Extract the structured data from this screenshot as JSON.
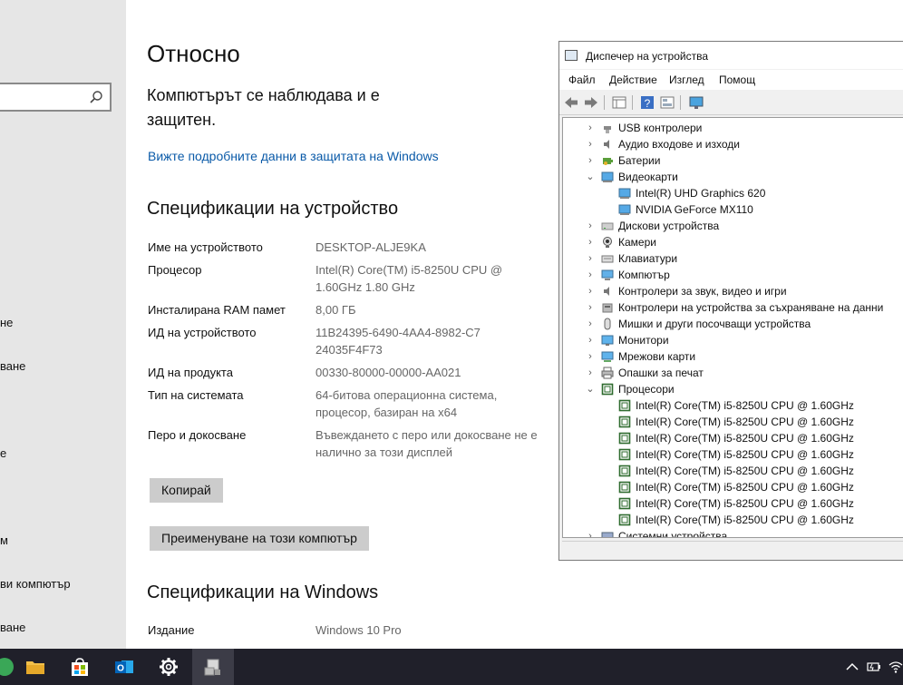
{
  "settings_nav": {
    "search_placeholder": "",
    "items": [
      "не",
      "ване",
      "е",
      "м",
      "ви компютър",
      "ване"
    ]
  },
  "about": {
    "title": "Относно",
    "protection_text": "Компютърът се наблюдава и е защитен.",
    "security_link": "Вижте подробните данни в защитата на Windows",
    "device_specs_title": "Спецификации на устройство",
    "specs": [
      {
        "label": "Име на устройството",
        "value": "DESKTOP-ALJE9KA"
      },
      {
        "label": "Процесор",
        "value": "Intel(R) Core(TM) i5-8250U CPU @ 1.60GHz   1.80 GHz"
      },
      {
        "label": "Инсталирана RAM памет",
        "value": "8,00 ГБ"
      },
      {
        "label": "ИД на устройството",
        "value": "11B24395-6490-4AA4-8982-C724035F4F73"
      },
      {
        "label": "ИД на продукта",
        "value": "00330-80000-00000-AA021"
      },
      {
        "label": "Тип на системата",
        "value": "64-битова операционна система, процесор, базиран на x64"
      },
      {
        "label": "Перо и докосване",
        "value": "Въвеждането с перо или докосване не е налично за този дисплей"
      }
    ],
    "copy_button": "Копирай",
    "rename_button": "Преименуване на този компютър",
    "windows_specs_title": "Спецификации на Windows",
    "edition_label": "Издание",
    "edition_value": "Windows 10 Pro"
  },
  "device_manager": {
    "title": "Диспечер на устройства",
    "menu": [
      "Файл",
      "Действие",
      "Изглед",
      "Помощ"
    ],
    "tree": [
      {
        "label": "USB контролери",
        "level": 0,
        "expanded": false,
        "icon": "usb-icon"
      },
      {
        "label": "Аудио входове и изходи",
        "level": 0,
        "expanded": false,
        "icon": "audio-icon"
      },
      {
        "label": "Батерии",
        "level": 0,
        "expanded": false,
        "icon": "battery-icon"
      },
      {
        "label": "Видеокарти",
        "level": 0,
        "expanded": true,
        "icon": "display-adapter-icon"
      },
      {
        "label": "Intel(R) UHD Graphics 620",
        "level": 1,
        "icon": "display-adapter-icon"
      },
      {
        "label": "NVIDIA GeForce MX110",
        "level": 1,
        "icon": "display-adapter-icon"
      },
      {
        "label": "Дискови устройства",
        "level": 0,
        "expanded": false,
        "icon": "disk-icon"
      },
      {
        "label": "Камери",
        "level": 0,
        "expanded": false,
        "icon": "camera-icon"
      },
      {
        "label": "Клавиатури",
        "level": 0,
        "expanded": false,
        "icon": "keyboard-icon"
      },
      {
        "label": "Компютър",
        "level": 0,
        "expanded": false,
        "icon": "computer-icon"
      },
      {
        "label": "Контролери за звук, видео и игри",
        "level": 0,
        "expanded": false,
        "icon": "speaker-icon"
      },
      {
        "label": "Контролери на устройства за съхраняване на данни",
        "level": 0,
        "expanded": false,
        "icon": "storage-icon"
      },
      {
        "label": "Мишки и други посочващи устройства",
        "level": 0,
        "expanded": false,
        "icon": "mouse-icon"
      },
      {
        "label": "Монитори",
        "level": 0,
        "expanded": false,
        "icon": "monitor-icon"
      },
      {
        "label": "Мрежови карти",
        "level": 0,
        "expanded": false,
        "icon": "network-icon"
      },
      {
        "label": "Опашки за печат",
        "level": 0,
        "expanded": false,
        "icon": "printer-icon"
      },
      {
        "label": "Процесори",
        "level": 0,
        "expanded": true,
        "icon": "processor-icon"
      },
      {
        "label": "Intel(R) Core(TM) i5-8250U CPU @ 1.60GHz",
        "level": 1,
        "icon": "processor-icon"
      },
      {
        "label": "Intel(R) Core(TM) i5-8250U CPU @ 1.60GHz",
        "level": 1,
        "icon": "processor-icon"
      },
      {
        "label": "Intel(R) Core(TM) i5-8250U CPU @ 1.60GHz",
        "level": 1,
        "icon": "processor-icon"
      },
      {
        "label": "Intel(R) Core(TM) i5-8250U CPU @ 1.60GHz",
        "level": 1,
        "icon": "processor-icon"
      },
      {
        "label": "Intel(R) Core(TM) i5-8250U CPU @ 1.60GHz",
        "level": 1,
        "icon": "processor-icon"
      },
      {
        "label": "Intel(R) Core(TM) i5-8250U CPU @ 1.60GHz",
        "level": 1,
        "icon": "processor-icon"
      },
      {
        "label": "Intel(R) Core(TM) i5-8250U CPU @ 1.60GHz",
        "level": 1,
        "icon": "processor-icon"
      },
      {
        "label": "Intel(R) Core(TM) i5-8250U CPU @ 1.60GHz",
        "level": 1,
        "icon": "processor-icon"
      },
      {
        "label": "Системни устройства",
        "level": 0,
        "expanded": false,
        "icon": "system-devices-icon"
      }
    ]
  },
  "taskbar": {
    "apps": [
      {
        "name": "file-explorer",
        "icon": "folder-icon"
      },
      {
        "name": "microsoft-store",
        "icon": "store-icon"
      },
      {
        "name": "outlook",
        "icon": "outlook-icon",
        "letter": "O"
      },
      {
        "name": "settings",
        "icon": "gear-icon"
      },
      {
        "name": "device-manager",
        "icon": "device-manager-icon"
      }
    ]
  },
  "colors": {
    "link": "#0a5aa8",
    "nav_bg": "#e6e6e6",
    "taskbar_bg": "#20202a",
    "button_bg": "#cccccc"
  }
}
